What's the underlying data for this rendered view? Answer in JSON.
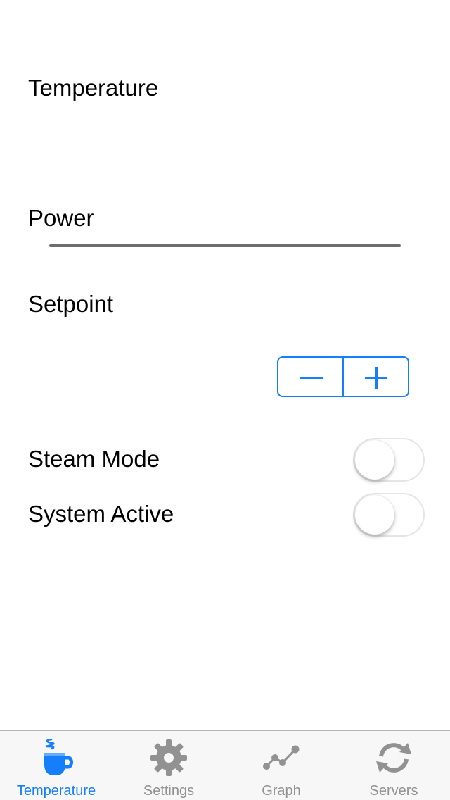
{
  "labels": {
    "temperature": "Temperature",
    "power": "Power",
    "setpoint": "Setpoint",
    "steam_mode": "Steam Mode",
    "system_active": "System Active"
  },
  "power": {
    "progress": 0
  },
  "setpoint_stepper": {
    "decrement": "minus-icon",
    "increment": "plus-icon"
  },
  "switches": {
    "steam_mode": false,
    "system_active": false
  },
  "colors": {
    "accent": "#147efb",
    "inactive": "#929292",
    "track": "#6e6e6e"
  },
  "tabbar": {
    "selected": "temperature",
    "tabs": [
      {
        "label": "Temperature",
        "icon": "coffee-cup-icon"
      },
      {
        "label": "Settings",
        "icon": "gear-icon"
      },
      {
        "label": "Graph",
        "icon": "graph-icon"
      },
      {
        "label": "Servers",
        "icon": "refresh-icon"
      }
    ]
  }
}
